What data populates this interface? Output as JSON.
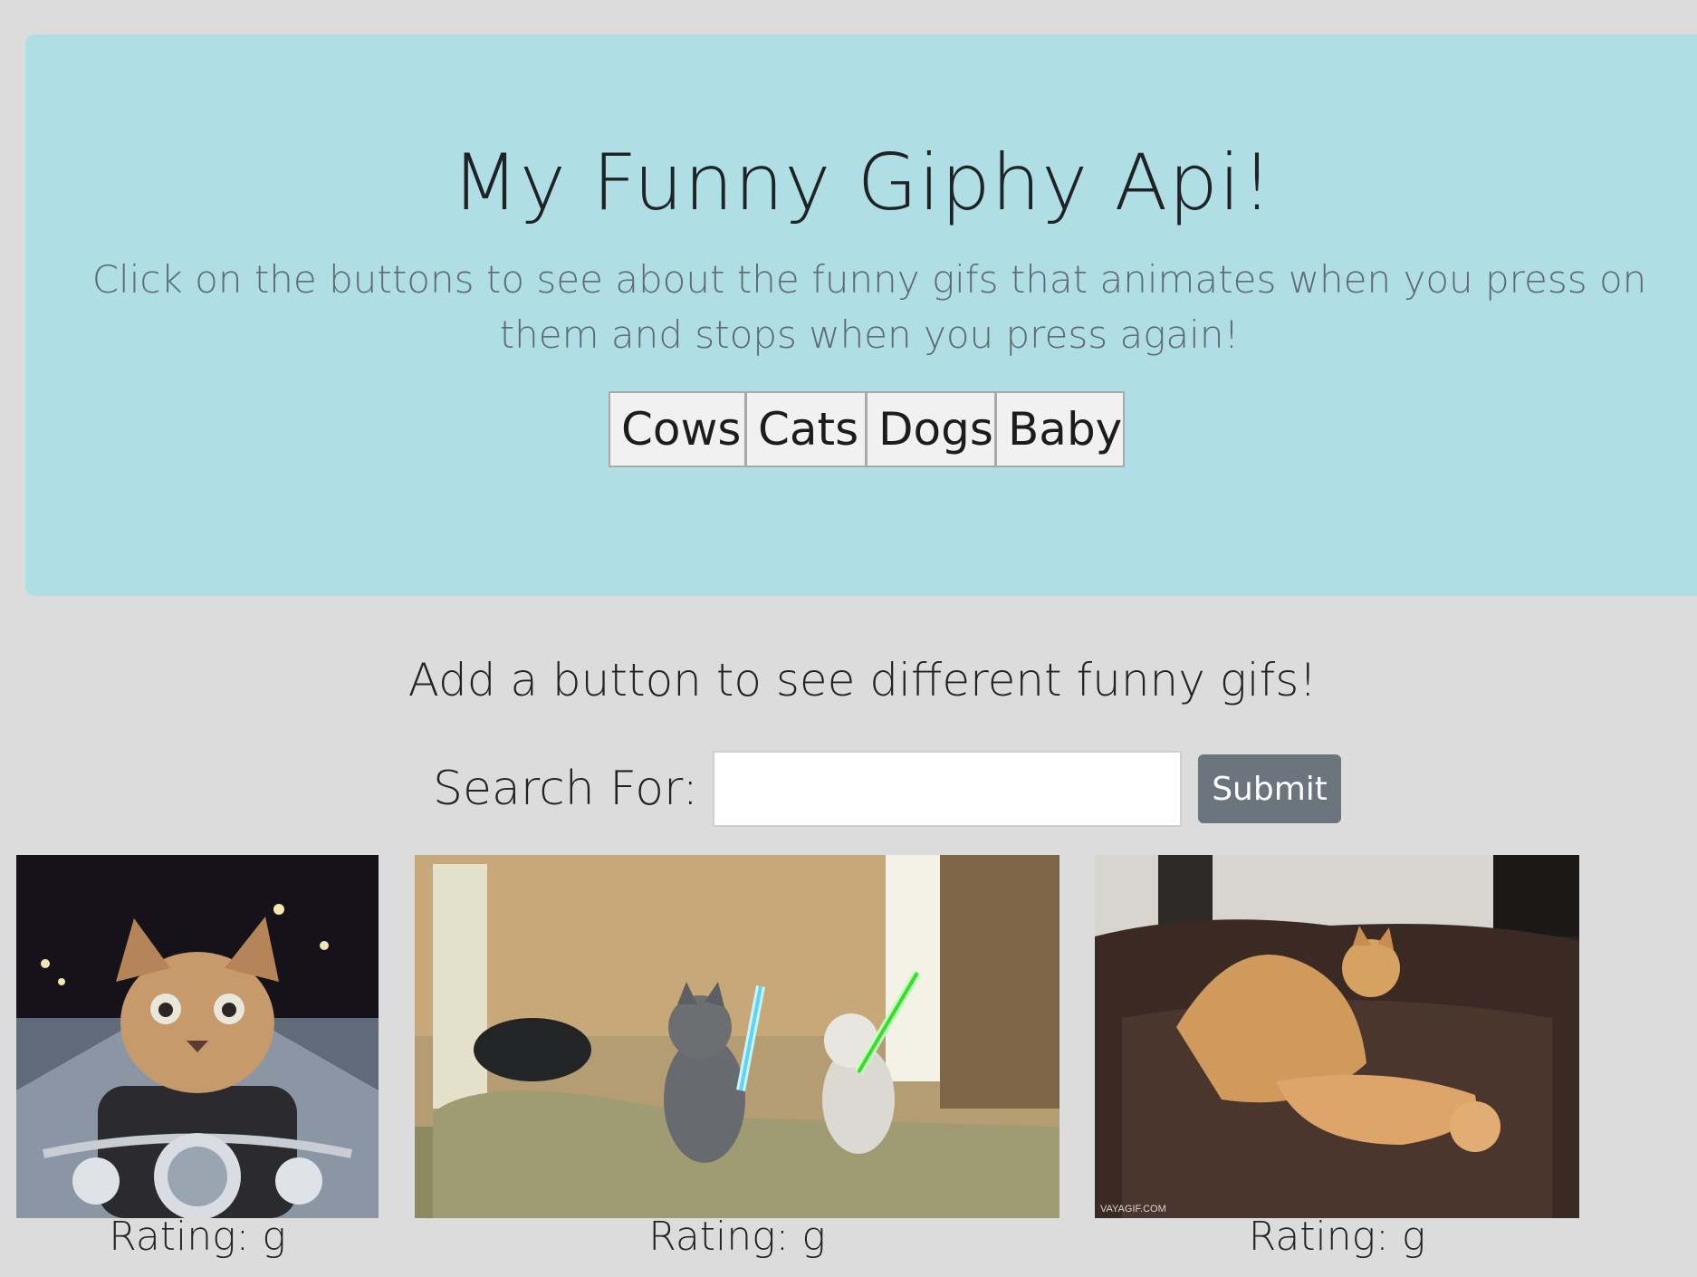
{
  "header": {
    "title": "My Funny Giphy Api!",
    "subtitle": "Click on the buttons to see about the funny gifs that animates when you press on them and stops when you press again!",
    "topic_buttons": [
      "Cows",
      "Cats",
      "Dogs",
      "Baby"
    ]
  },
  "form": {
    "heading": "Add a button to see different funny gifs!",
    "search_label": "Search For:",
    "search_value": "",
    "submit_label": "Submit"
  },
  "gifs": [
    {
      "rating_label": "Rating: g"
    },
    {
      "rating_label": "Rating: g",
      "watermark": ""
    },
    {
      "rating_label": "Rating: g",
      "watermark": "VAYAGIF.COM"
    }
  ],
  "colors": {
    "page_background": "#dcdcdc",
    "jumbotron_background": "#afdfe4",
    "submit_background": "#6c757d"
  }
}
